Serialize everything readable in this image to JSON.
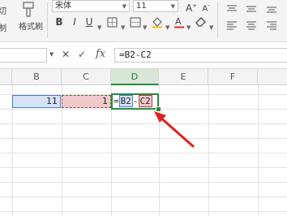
{
  "ribbon": {
    "clipboard": {
      "cut_label": "剪切",
      "copy_label": "复制",
      "format_painter_label": "格式刷"
    },
    "font": {
      "name": "宋体",
      "size": "11",
      "grow_icon": "A⁺",
      "shrink_icon": "A⁻",
      "bold": "B",
      "italic": "I",
      "underline": "U"
    }
  },
  "formula_bar": {
    "cancel_symbol": "✕",
    "confirm_symbol": "✓",
    "fx_label": "fx",
    "formula": "=B2-C2"
  },
  "columns": [
    "B",
    "C",
    "D",
    "E",
    "F"
  ],
  "active_column": "D",
  "cells": {
    "B2": "11",
    "C2": "1",
    "D2_prefix": "=",
    "D2_ref_b": "B2",
    "D2_op": "-",
    "D2_ref_c": "C2"
  },
  "colors": {
    "active_green": "#2b8a3e",
    "ref_blue": "#4b79d6",
    "ref_red": "#b04040",
    "arrow_red": "#e02020"
  }
}
